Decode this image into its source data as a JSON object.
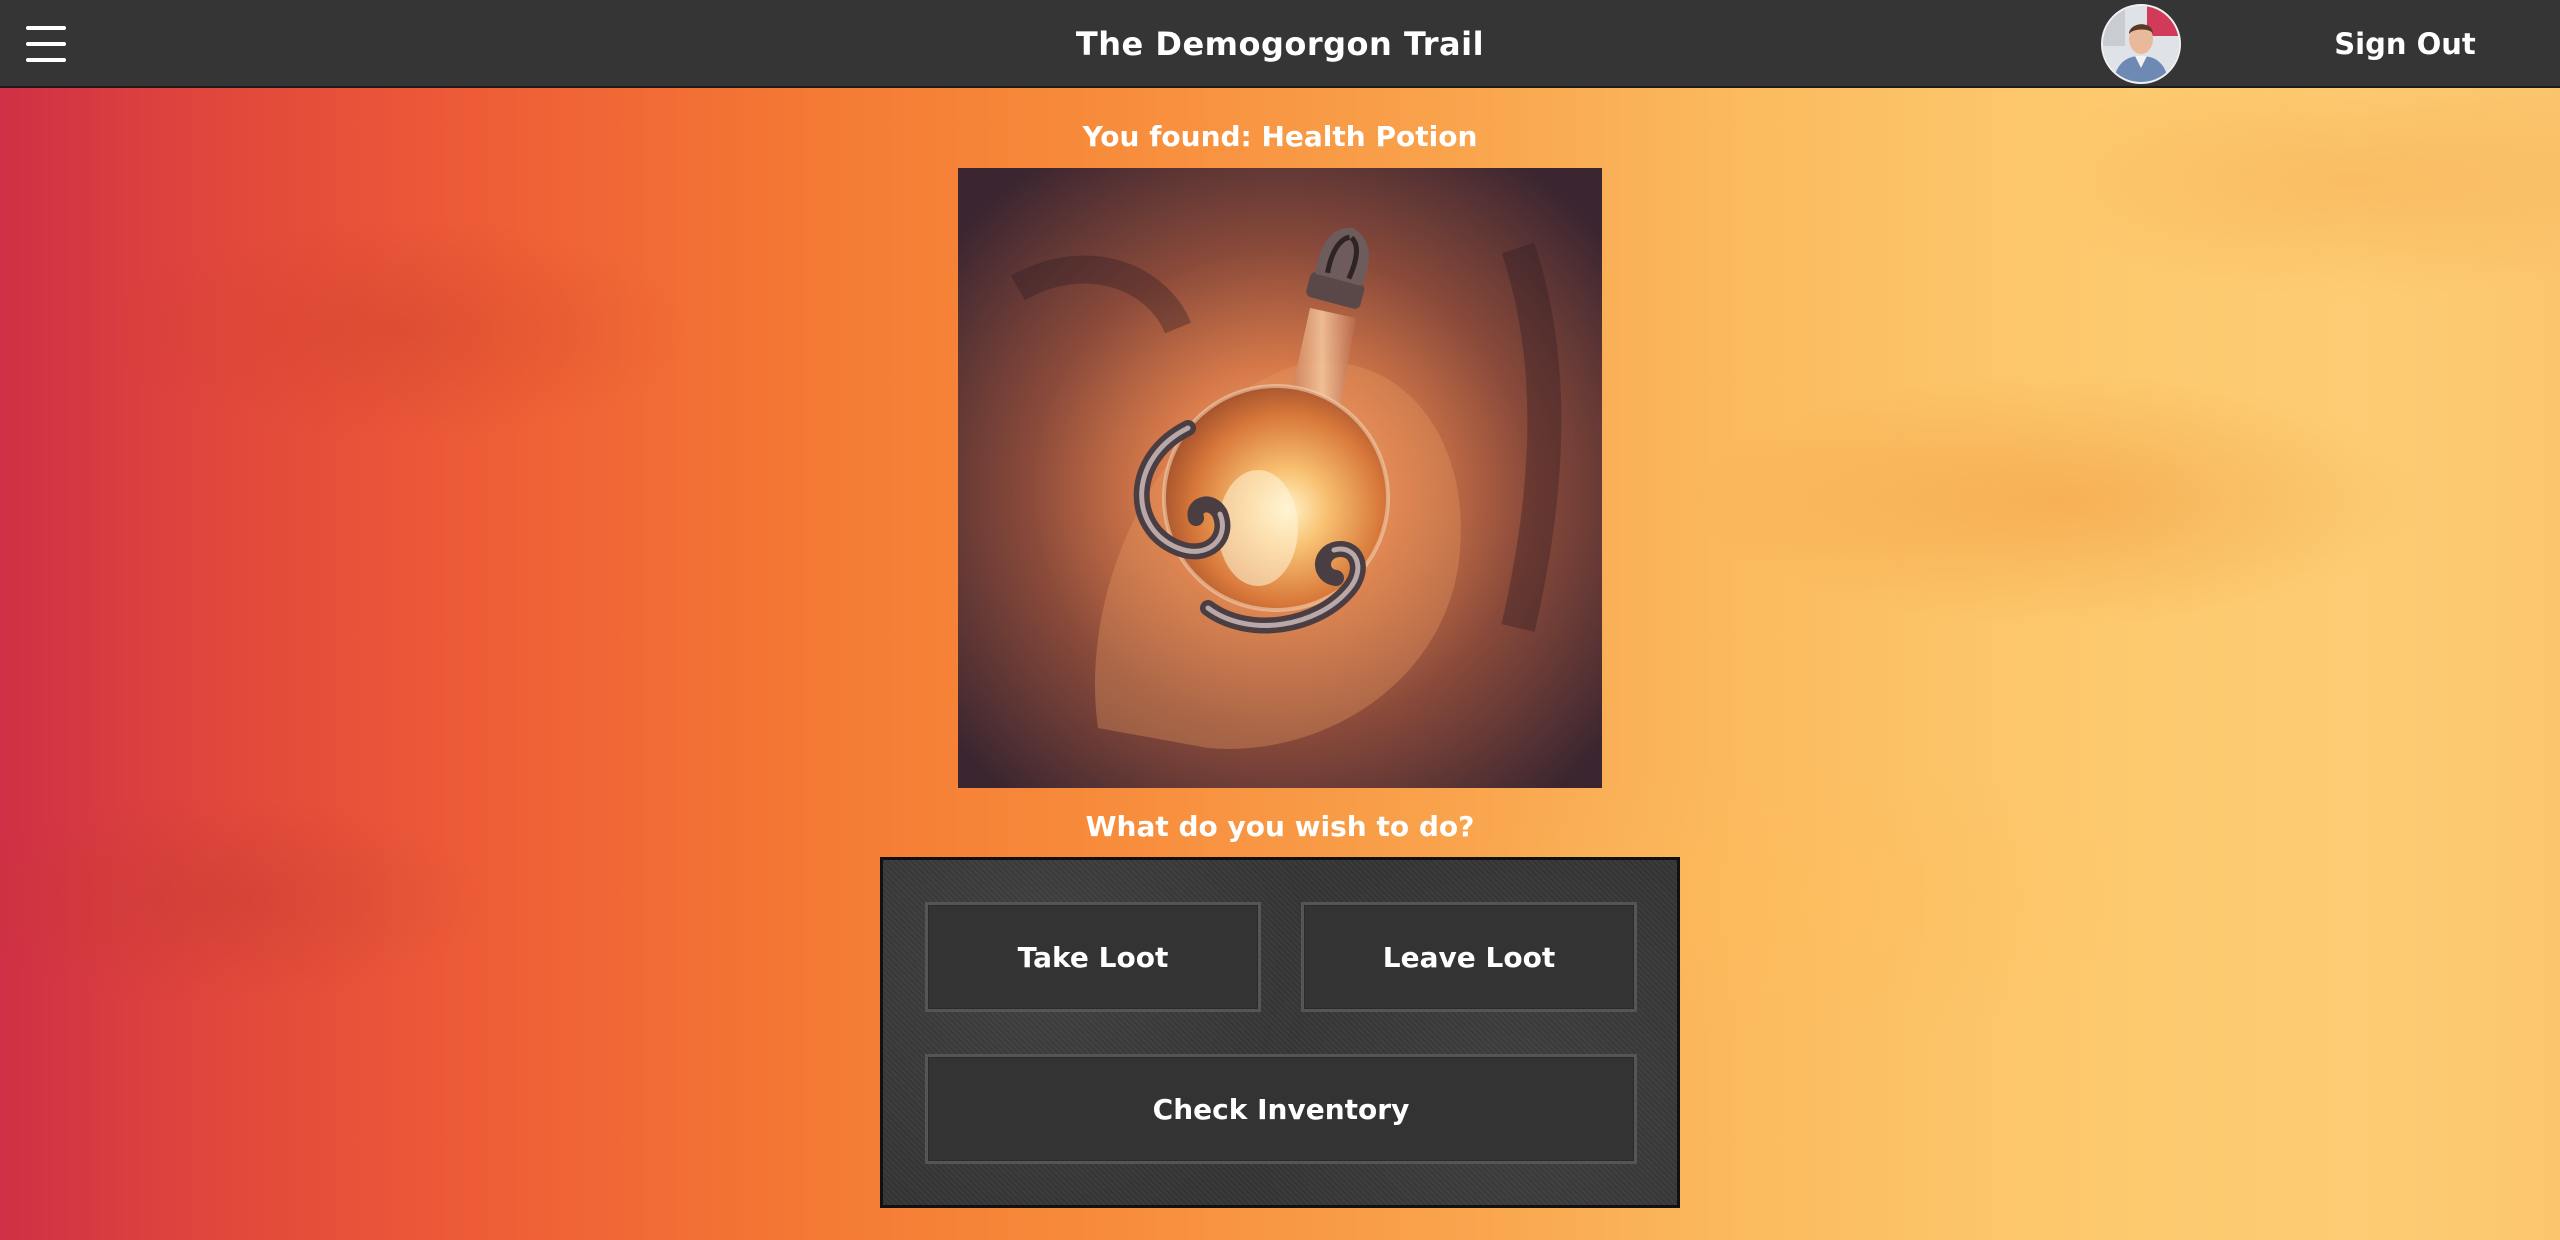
{
  "header": {
    "title": "The Demogorgon Trail",
    "menu_icon": "hamburger-menu-icon",
    "avatar_icon": "user-avatar",
    "sign_out_label": "Sign Out"
  },
  "encounter": {
    "found_text": "You found: Health Potion",
    "item_image_icon": "health-potion-image",
    "prompt": "What do you wish to do?"
  },
  "actions": {
    "take_loot_label": "Take Loot",
    "leave_loot_label": "Leave Loot",
    "check_inventory_label": "Check Inventory"
  },
  "colors": {
    "header_bg": "#353535",
    "button_bg": "#333333",
    "background_left": "#cf3045",
    "background_right": "#fccd74"
  }
}
